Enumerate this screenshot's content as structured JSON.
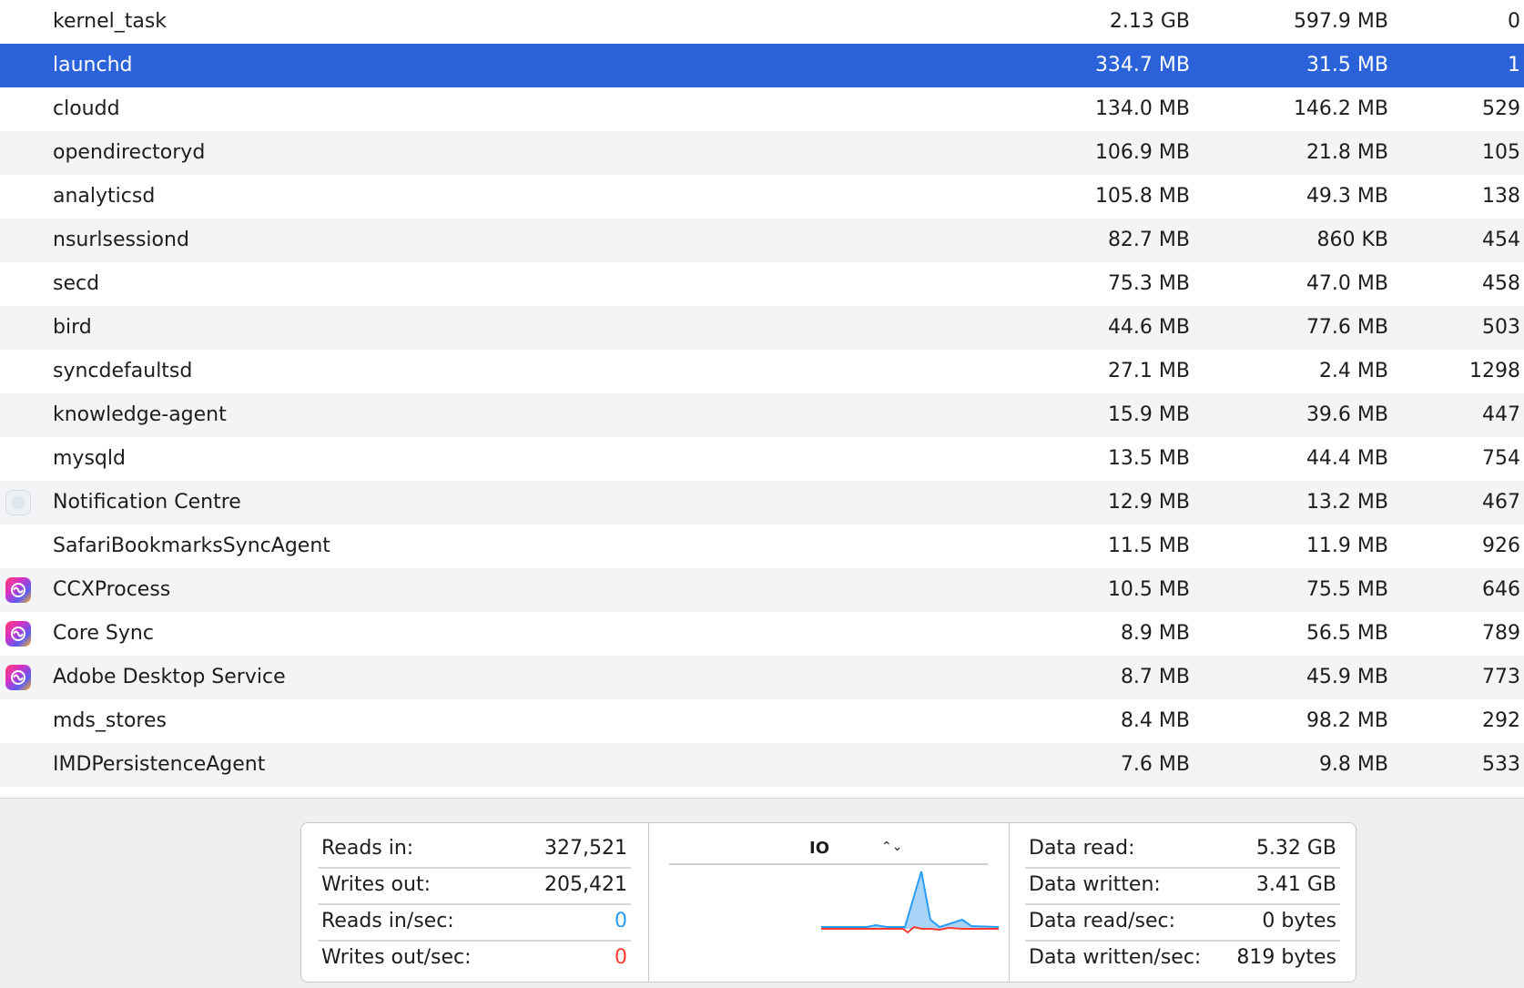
{
  "processes": [
    {
      "name": "kernel_task",
      "memory": "2.13 GB",
      "compressed": "597.9 MB",
      "pid": "0",
      "icon": ""
    },
    {
      "name": "launchd",
      "memory": "334.7 MB",
      "compressed": "31.5 MB",
      "pid": "1",
      "icon": "",
      "selected": true
    },
    {
      "name": "cloudd",
      "memory": "134.0 MB",
      "compressed": "146.2 MB",
      "pid": "529",
      "icon": ""
    },
    {
      "name": "opendirectoryd",
      "memory": "106.9 MB",
      "compressed": "21.8 MB",
      "pid": "105",
      "icon": ""
    },
    {
      "name": "analyticsd",
      "memory": "105.8 MB",
      "compressed": "49.3 MB",
      "pid": "138",
      "icon": ""
    },
    {
      "name": "nsurlsessiond",
      "memory": "82.7 MB",
      "compressed": "860 KB",
      "pid": "454",
      "icon": ""
    },
    {
      "name": "secd",
      "memory": "75.3 MB",
      "compressed": "47.0 MB",
      "pid": "458",
      "icon": ""
    },
    {
      "name": "bird",
      "memory": "44.6 MB",
      "compressed": "77.6 MB",
      "pid": "503",
      "icon": ""
    },
    {
      "name": "syncdefaultsd",
      "memory": "27.1 MB",
      "compressed": "2.4 MB",
      "pid": "1298",
      "icon": ""
    },
    {
      "name": "knowledge-agent",
      "memory": "15.9 MB",
      "compressed": "39.6 MB",
      "pid": "447",
      "icon": ""
    },
    {
      "name": "mysqld",
      "memory": "13.5 MB",
      "compressed": "44.4 MB",
      "pid": "754",
      "icon": ""
    },
    {
      "name": "Notification Centre",
      "memory": "12.9 MB",
      "compressed": "13.2 MB",
      "pid": "467",
      "icon": "notification-centre-icon"
    },
    {
      "name": "SafariBookmarksSyncAgent",
      "memory": "11.5 MB",
      "compressed": "11.9 MB",
      "pid": "926",
      "icon": ""
    },
    {
      "name": "CCXProcess",
      "memory": "10.5 MB",
      "compressed": "75.5 MB",
      "pid": "646",
      "icon": "creative-cloud-icon"
    },
    {
      "name": "Core Sync",
      "memory": "8.9 MB",
      "compressed": "56.5 MB",
      "pid": "789",
      "icon": "creative-cloud-icon"
    },
    {
      "name": "Adobe Desktop Service",
      "memory": "8.7 MB",
      "compressed": "45.9 MB",
      "pid": "773",
      "icon": "creative-cloud-icon"
    },
    {
      "name": "mds_stores",
      "memory": "8.4 MB",
      "compressed": "98.2 MB",
      "pid": "292",
      "icon": ""
    },
    {
      "name": "IMDPersistenceAgent",
      "memory": "7.6 MB",
      "compressed": "9.8 MB",
      "pid": "533",
      "icon": ""
    }
  ],
  "stats_left": {
    "reads_in_label": "Reads in:",
    "reads_in": "327,521",
    "writes_out_label": "Writes out:",
    "writes_out": "205,421",
    "reads_in_sec_label": "Reads in/sec:",
    "reads_in_sec": "0",
    "writes_out_sec_label": "Writes out/sec:",
    "writes_out_sec": "0"
  },
  "graph": {
    "selector_label": "IO",
    "selector_arrows": "⌃⌄",
    "read_color": "#2a9cf3",
    "write_color": "#ff3b2f"
  },
  "stats_right": {
    "data_read_label": "Data read:",
    "data_read": "5.32 GB",
    "data_written_label": "Data written:",
    "data_written": "3.41 GB",
    "data_read_sec_label": "Data read/sec:",
    "data_read_sec": "0 bytes",
    "data_written_sec_label": "Data written/sec:",
    "data_written_sec": "819 bytes"
  },
  "colors": {
    "selection": "#2b62d9",
    "alt_row": "#f4f4f6"
  }
}
